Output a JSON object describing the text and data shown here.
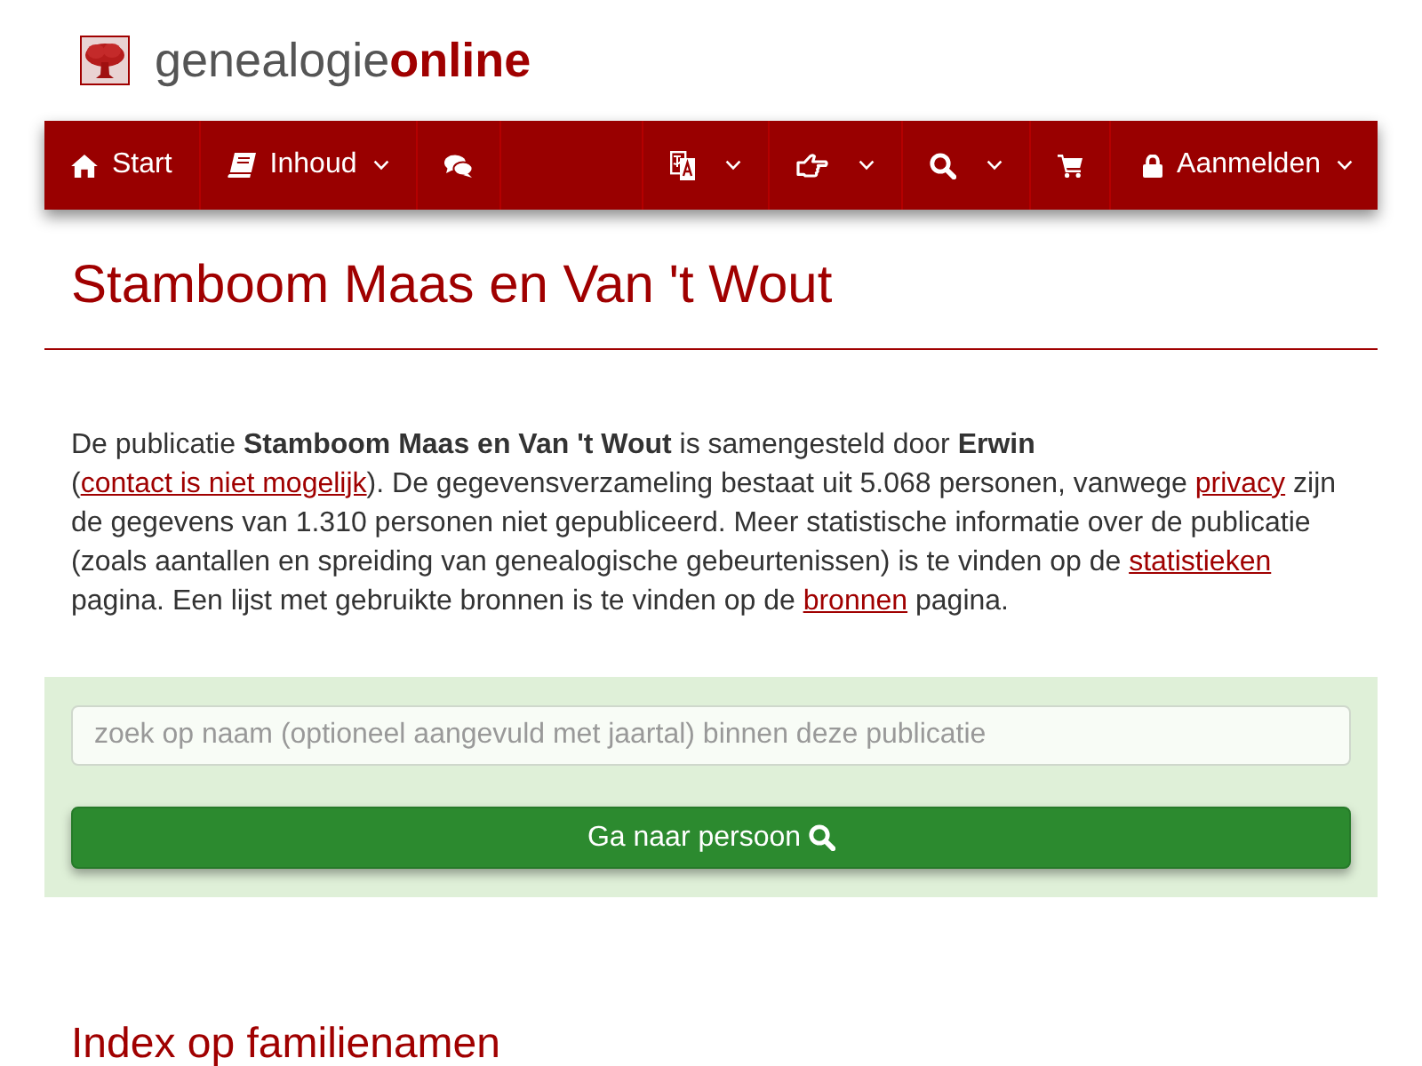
{
  "logo_text": "genealogie**online**",
  "navbar": {
    "left_items": [
      {
        "label": "Start",
        "has_menu": false
      },
      {
        "label": "Inhoud",
        "has_menu": true
      },
      {
        "has_menu": false
      }
    ],
    "right_items": [
      {
        "has_menu": true
      },
      {
        "has_menu": true
      },
      {
        "has_menu": true
      },
      {
        "has_menu": false
      },
      {
        "label": "Aanmelden",
        "has_menu": true
      }
    ]
  },
  "page_title": "Stamboom Maas en Van 't Wout",
  "intro": [
    {
      "kind": "text",
      "text": "De publicatie **Stamboom Maas en Van 't Wout** is samengesteld door **Erwin** ("
    },
    {
      "kind": "link",
      "text": "contact is niet mogelijk"
    },
    {
      "kind": "text",
      "text": "). De gegevensverzameling bestaat uit 5.068 personen, vanwege "
    },
    {
      "kind": "link",
      "text": "privacy"
    },
    {
      "kind": "text",
      "text": " zijn de gegevens van 1.310 personen niet gepubliceerd. Meer statistische informatie over de publicatie (zoals aantallen en spreiding van genealogische gebeurtenissen) is te vinden op de "
    },
    {
      "kind": "link",
      "text": "statistieken"
    },
    {
      "kind": "text",
      "text": " pagina. Een lijst met gebruikte bronnen is te vinden op de "
    },
    {
      "kind": "link",
      "text": "bronnen"
    },
    {
      "kind": "text",
      "text": " pagina."
    }
  ],
  "search": {
    "placeholder": "zoek op naam (optioneel aangevuld met jaartal) binnen deze publicatie",
    "button": "Ga naar persoon"
  },
  "section_heading": "Index op familienamen"
}
